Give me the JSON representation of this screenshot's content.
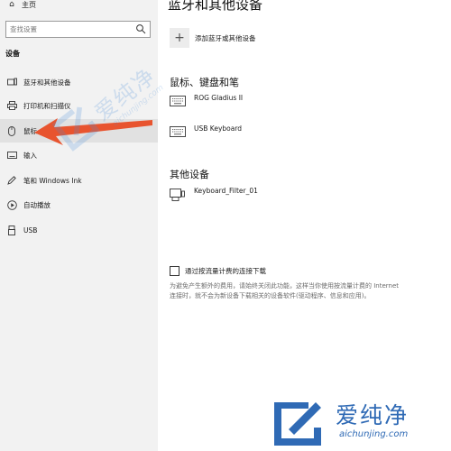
{
  "sidebar": {
    "home_label": "主页",
    "search_placeholder": "查找设置",
    "section_label": "设备",
    "items": [
      {
        "label": "蓝牙和其他设备",
        "icon": "bluetooth-devices-icon"
      },
      {
        "label": "打印机和扫描仪",
        "icon": "printer-icon"
      },
      {
        "label": "鼠标",
        "icon": "mouse-icon"
      },
      {
        "label": "输入",
        "icon": "keyboard-icon"
      },
      {
        "label": "笔和 Windows Ink",
        "icon": "pen-icon"
      },
      {
        "label": "自动播放",
        "icon": "autoplay-icon"
      },
      {
        "label": "USB",
        "icon": "usb-icon"
      }
    ],
    "active_index": 2
  },
  "main": {
    "title": "蓝牙和其他设备",
    "add_device_label": "添加蓝牙或其他设备",
    "groups": [
      {
        "title": "鼠标、键盘和笔",
        "devices": [
          "ROG Gladius II",
          "USB Keyboard"
        ]
      },
      {
        "title": "其他设备",
        "devices": [
          "Keyboard_Filter_01"
        ]
      }
    ],
    "metered_label": "通过按流量计费的连接下载",
    "metered_checked": false,
    "metered_desc": "为避免产生额外的费用，请始终关闭此功能，这样当你使用按流量计费的 Internet 连接时，就不会为新设备下载相关的设备软件(驱动程序、信息和应用)。"
  },
  "watermark": {
    "brand_cn": "爱纯净",
    "brand_url": "aichunjing.com",
    "mark_cn": "爱纯净",
    "mark_url": "aichunjing.com"
  },
  "colors": {
    "sidebar_bg": "#f2f2f2",
    "active_bg": "#e1e1e1",
    "arrow": "#e8542f",
    "watermark": "#2f6ab5"
  }
}
